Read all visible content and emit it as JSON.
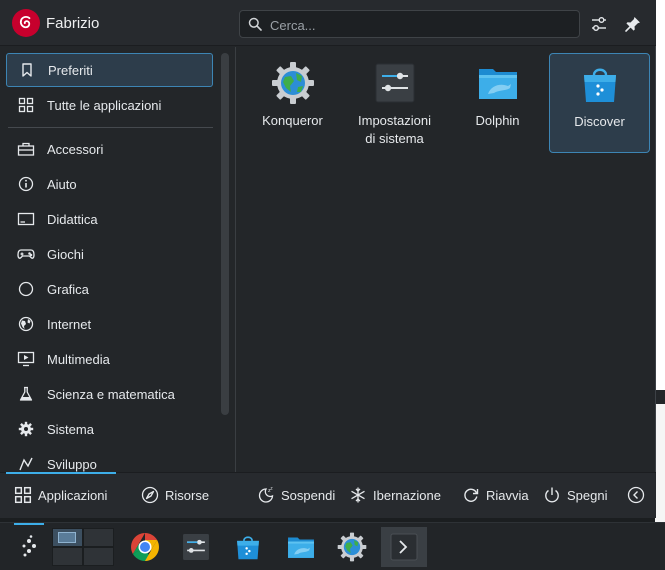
{
  "user": {
    "name": "Fabrizio"
  },
  "search": {
    "placeholder": "Cerca..."
  },
  "header": {
    "configure_icon": "sliders-icon",
    "pin_icon": "pin-icon"
  },
  "sidebar": {
    "items": [
      {
        "label": "Preferiti",
        "icon": "bookmark-icon",
        "selected": true
      },
      {
        "label": "Tutte le applicazioni",
        "icon": "grid-icon"
      },
      {
        "label": "Accessori",
        "icon": "toolbox-icon"
      },
      {
        "label": "Aiuto",
        "icon": "info-icon"
      },
      {
        "label": "Didattica",
        "icon": "education-icon"
      },
      {
        "label": "Giochi",
        "icon": "gamepad-icon"
      },
      {
        "label": "Grafica",
        "icon": "palette-icon"
      },
      {
        "label": "Internet",
        "icon": "globe-icon"
      },
      {
        "label": "Multimedia",
        "icon": "monitor-play-icon"
      },
      {
        "label": "Scienza e matematica",
        "icon": "flask-icon"
      },
      {
        "label": "Sistema",
        "icon": "gear-icon"
      },
      {
        "label": "Sviluppo",
        "icon": "development-icon"
      }
    ]
  },
  "apps": [
    {
      "label": "Konqueror",
      "icon": "konqueror-globe-icon"
    },
    {
      "label": "Impostazioni\ndi sistema",
      "icon": "system-settings-icon"
    },
    {
      "label": "Dolphin",
      "icon": "dolphin-folder-icon"
    },
    {
      "label": "Discover",
      "icon": "discover-bag-icon",
      "selected": true
    }
  ],
  "footer": {
    "tabs": [
      {
        "label": "Applicazioni",
        "active": true
      },
      {
        "label": "Risorse"
      }
    ],
    "actions": [
      {
        "label": "Sospendi"
      },
      {
        "label": "Ibernazione"
      },
      {
        "label": "Riavvia"
      },
      {
        "label": "Spegni"
      }
    ]
  },
  "taskbar": {
    "items": [
      "kde-launcher-icon",
      "virtual-desktop-pager",
      "chrome-icon",
      "system-settings-icon",
      "discover-icon",
      "dolphin-icon",
      "konqueror-icon",
      "konsole-icon"
    ]
  },
  "colors": {
    "accent": "#3daee9",
    "selection": "#2d3d4b",
    "background": "#232629"
  }
}
